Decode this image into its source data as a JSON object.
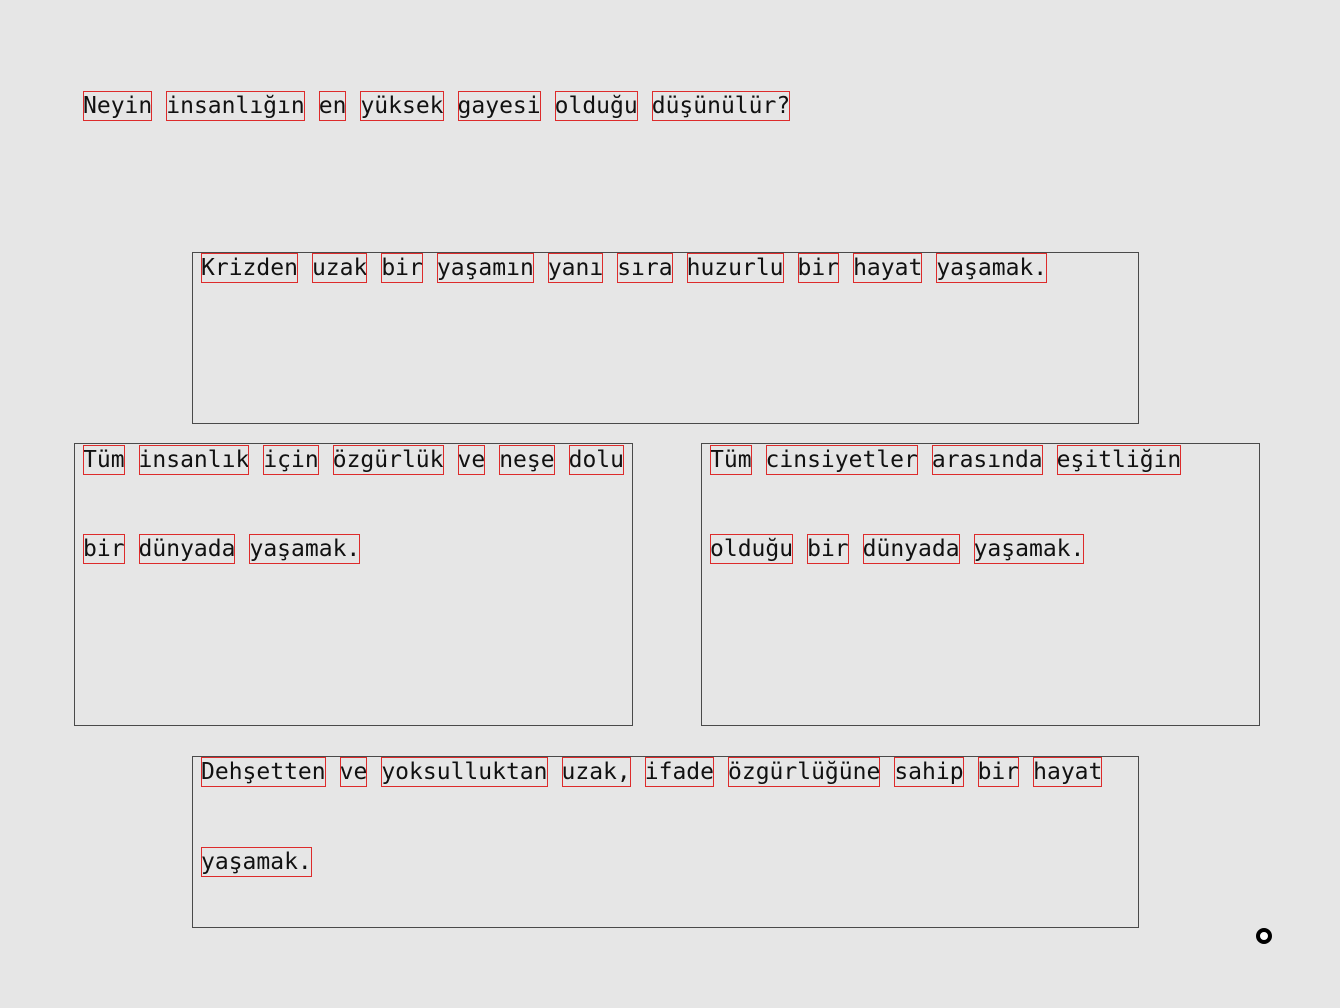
{
  "question": "Neyin insanlığın en yüksek gayesi olduğu düşünülür?",
  "options": [
    {
      "id": "option-top",
      "lines": [
        "Krizden uzak bir yaşamın yanı sıra huzurlu bir hayat yaşamak."
      ]
    },
    {
      "id": "option-left",
      "lines": [
        "Tüm insanlık için özgürlük ve neşe dolu",
        "bir dünyada yaşamak."
      ]
    },
    {
      "id": "option-right",
      "lines": [
        "Tüm cinsiyetler arasında eşitliğin",
        "olduğu bir dünyada yaşamak."
      ]
    },
    {
      "id": "option-bottom",
      "lines": [
        "Dehşetten ve yoksulluktan uzak, ifade özgürlüğüne sahip bir hayat",
        "yaşamak."
      ]
    }
  ]
}
